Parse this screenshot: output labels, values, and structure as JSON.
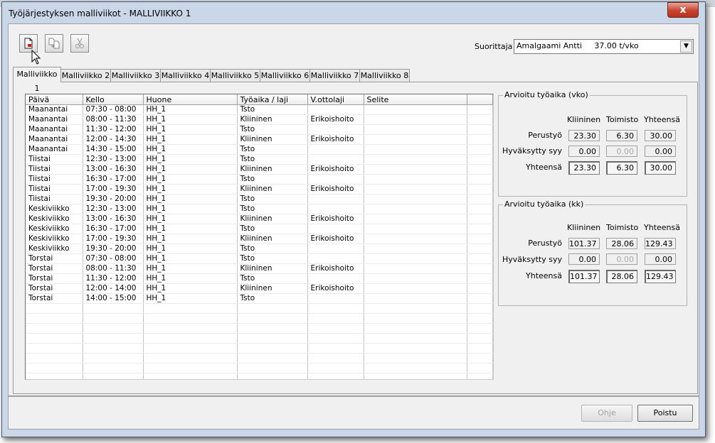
{
  "window": {
    "title": "Työjärjestyksen malliviikot - MALLIVIIKKO 1",
    "close_label": "x"
  },
  "performer": {
    "label": "Suorittaja",
    "value": "Amalgaami Antti     37.00 t/vko",
    "dropdown_arrow": "▼"
  },
  "toolbar": {
    "icons": [
      "new-document-icon",
      "copy-document-icon",
      "cut-icon"
    ]
  },
  "tabs": [
    "Malliviikko 1",
    "Malliviikko 2",
    "Malliviikko 3",
    "Malliviikko 4",
    "Malliviikko 5",
    "Malliviikko 6",
    "Malliviikko 7",
    "Malliviikko 8"
  ],
  "active_tab": "Malliviikko 1",
  "table": {
    "columns": [
      "Päivä",
      "Kello",
      "Huone",
      "Työaika / laji",
      "V.ottolaji",
      "Selite"
    ],
    "rows": [
      [
        "Maanantai",
        "07:30 - 08:00",
        "HH_1",
        "Tsto",
        "",
        ""
      ],
      [
        "Maanantai",
        "08:00 - 11:30",
        "HH_1",
        "Kliininen",
        "Erikoishoito",
        ""
      ],
      [
        "Maanantai",
        "11:30 - 12:00",
        "HH_1",
        "Tsto",
        "",
        ""
      ],
      [
        "Maanantai",
        "12:00 - 14:30",
        "HH_1",
        "Kliininen",
        "Erikoishoito",
        ""
      ],
      [
        "Maanantai",
        "14:30 - 15:00",
        "HH_1",
        "Tsto",
        "",
        ""
      ],
      [
        "Tiistai",
        "12:30 - 13:00",
        "HH_1",
        "Tsto",
        "",
        ""
      ],
      [
        "Tiistai",
        "13:00 - 16:30",
        "HH_1",
        "Kliininen",
        "Erikoishoito",
        ""
      ],
      [
        "Tiistai",
        "16:30 - 17:00",
        "HH_1",
        "Tsto",
        "",
        ""
      ],
      [
        "Tiistai",
        "17:00 - 19:30",
        "HH_1",
        "Kliininen",
        "Erikoishoito",
        ""
      ],
      [
        "Tiistai",
        "19:30 - 20:00",
        "HH_1",
        "Tsto",
        "",
        ""
      ],
      [
        "Keskiviikko",
        "12:30 - 13:00",
        "HH_1",
        "Tsto",
        "",
        ""
      ],
      [
        "Keskiviikko",
        "13:00 - 16:30",
        "HH_1",
        "Kliininen",
        "Erikoishoito",
        ""
      ],
      [
        "Keskiviikko",
        "16:30 - 17:00",
        "HH_1",
        "Tsto",
        "",
        ""
      ],
      [
        "Keskiviikko",
        "17:00 - 19:30",
        "HH_1",
        "Kliininen",
        "Erikoishoito",
        ""
      ],
      [
        "Keskiviikko",
        "19:30 - 20:00",
        "HH_1",
        "Tsto",
        "",
        ""
      ],
      [
        "Torstai",
        "07:30 - 08:00",
        "HH_1",
        "Tsto",
        "",
        ""
      ],
      [
        "Torstai",
        "08:00 - 11:30",
        "HH_1",
        "Kliininen",
        "Erikoishoito",
        ""
      ],
      [
        "Torstai",
        "11:30 - 12:00",
        "HH_1",
        "Tsto",
        "",
        ""
      ],
      [
        "Torstai",
        "12:00 - 14:00",
        "HH_1",
        "Kliininen",
        "Erikoishoito",
        ""
      ],
      [
        "Torstai",
        "14:00 - 15:00",
        "HH_1",
        "Tsto",
        "",
        ""
      ],
      [
        "",
        "",
        "",
        "",
        "",
        ""
      ],
      [
        "",
        "",
        "",
        "",
        "",
        ""
      ],
      [
        "",
        "",
        "",
        "",
        "",
        ""
      ],
      [
        "",
        "",
        "",
        "",
        "",
        ""
      ],
      [
        "",
        "",
        "",
        "",
        "",
        ""
      ],
      [
        "",
        "",
        "",
        "",
        "",
        ""
      ],
      [
        "",
        "",
        "",
        "",
        "",
        ""
      ],
      [
        "",
        "",
        "",
        "",
        "",
        ""
      ]
    ]
  },
  "summary_week": {
    "title": "Arvioitu työaika (vko)",
    "col_headers": [
      "Kliininen",
      "Toimisto",
      "Yhteensä"
    ],
    "rows": [
      {
        "label": "Perustyö",
        "values": [
          "23.30",
          "6.30",
          "30.00"
        ]
      },
      {
        "label": "Hyväksytty syy",
        "values": [
          "0.00",
          "0.00",
          "0.00"
        ]
      },
      {
        "label": "Yhteensä",
        "values": [
          "23.30",
          "6.30",
          "30.00"
        ]
      }
    ]
  },
  "summary_month": {
    "title": "Arvioitu työaika (kk)",
    "col_headers": [
      "Kliininen",
      "Toimisto",
      "Yhteensä"
    ],
    "rows": [
      {
        "label": "Perustyö",
        "values": [
          "101.37",
          "28.06",
          "129.43"
        ]
      },
      {
        "label": "Hyväksytty syy",
        "values": [
          "0.00",
          "0.00",
          "0.00"
        ]
      },
      {
        "label": "Yhteensä",
        "values": [
          "101.37",
          "28.06",
          "129.43"
        ]
      }
    ]
  },
  "buttons": {
    "help": "Ohje",
    "exit": "Poistu"
  }
}
